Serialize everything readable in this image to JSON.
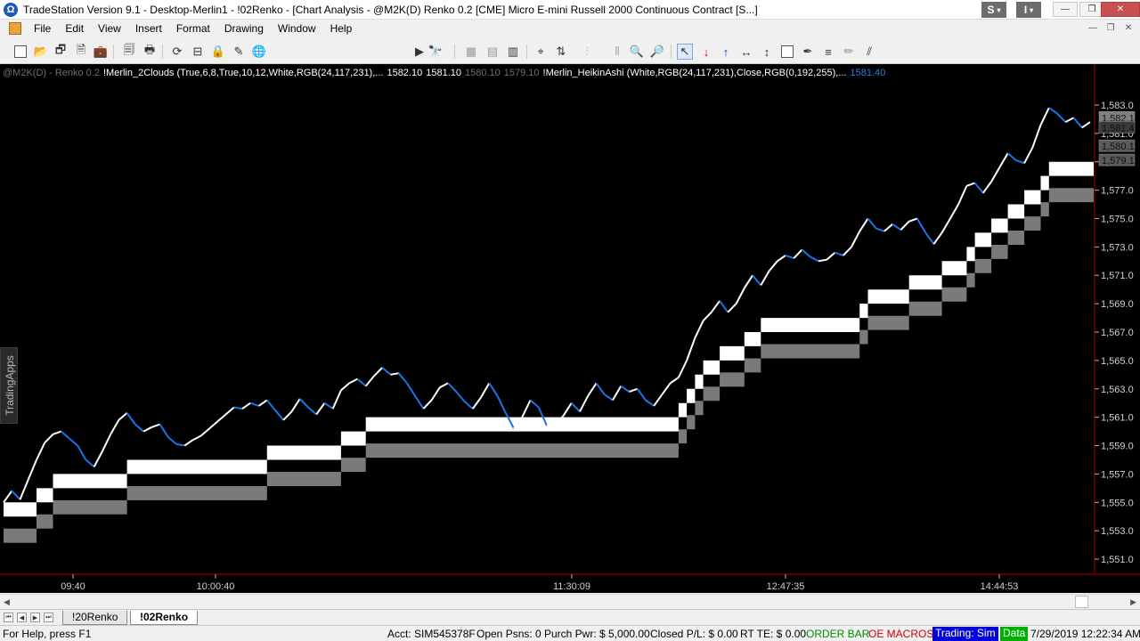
{
  "window": {
    "title": "TradeStation Version 9.1 - Desktop-Merlin1 - !02Renko - [Chart Analysis - @M2K(D) Renko 0.2 [CME] Micro E-mini Russell 2000 Continuous Contract [S...]",
    "app_icon_glyph": "Ω",
    "badge_s": "S",
    "badge_i": "I"
  },
  "menu": [
    "File",
    "Edit",
    "View",
    "Insert",
    "Format",
    "Drawing",
    "Window",
    "Help"
  ],
  "toolbar": {
    "combo_value": ".",
    "icons": [
      "new-document-icon",
      "open-folder-icon",
      "open-workspace-icon",
      "save-icon",
      "save-workspace-icon",
      "print-preview-icon",
      "print-icon",
      "window-refresh-icon",
      "window-arrange-icon",
      "lock-icon",
      "tool-icon",
      "globe-icon",
      "go-arrow-icon",
      "binoculars-icon",
      "grid-icon",
      "grid-alt-icon",
      "table-icon",
      "crosshair-icon",
      "strategy-icon",
      "zoom-in-icon",
      "zoom-out-icon",
      "pointer-icon",
      "down-arrow-icon",
      "up-arrow-icon",
      "horizontal-line-icon",
      "vertical-line-icon",
      "rectangle-icon",
      "pen-icon",
      "lines-icon",
      "pencil-icon",
      "trendlines-icon"
    ]
  },
  "legend": {
    "symbol": "@M2K(D) - Renko 0.2",
    "study1": "!Merlin_2Clouds (True,6,8,True,10,12,White,RGB(24,117,231),...",
    "v1": "1582.10",
    "v2": "1581.10",
    "v3": "1580.10",
    "v4": "1579.10",
    "study2": "!Merlin_HeikinAshi (White,RGB(24,117,231),Close,RGB(0,192,255),...",
    "v5": "1581.40"
  },
  "side_tab": "TradingApps",
  "chart_data": {
    "type": "line",
    "y_range": [
      1550.0,
      1584.0
    ],
    "y_ticks": [
      "1,583.0",
      "1,581.0",
      "1,579.0",
      "1,577.0",
      "1,575.0",
      "1,573.0",
      "1,571.0",
      "1,569.0",
      "1,567.0",
      "1,565.0",
      "1,563.0",
      "1,561.0",
      "1,559.0",
      "1,557.0",
      "1,555.0",
      "1,553.0",
      "1,551.0"
    ],
    "x_ticks": [
      "09:40",
      "10:00:40",
      "11:30:09",
      "12:47:35",
      "14:44:53"
    ],
    "price_labels": [
      "1,582.1",
      "1,581.4",
      "1,580.1",
      "1,579.1"
    ],
    "grid": false,
    "colors": {
      "up": "#ffffff",
      "down": "#1875e7",
      "cloud1": "#ffffff",
      "cloud2": "#7a7a7a",
      "axis": "#b00000"
    },
    "price": [
      1555.0,
      1555.8,
      1555.2,
      1556.6,
      1558.0,
      1559.2,
      1559.8,
      1560.0,
      1559.5,
      1559.0,
      1558.0,
      1557.5,
      1558.6,
      1559.8,
      1560.8,
      1561.3,
      1560.5,
      1560.0,
      1560.3,
      1560.5,
      1559.6,
      1559.1,
      1559.0,
      1559.4,
      1559.7,
      1560.2,
      1560.7,
      1561.2,
      1561.7,
      1561.6,
      1562.0,
      1561.8,
      1562.2,
      1561.5,
      1560.8,
      1561.4,
      1562.3,
      1561.7,
      1561.2,
      1562.0,
      1561.6,
      1562.9,
      1563.4,
      1563.7,
      1563.2,
      1563.9,
      1564.5,
      1564.0,
      1564.1,
      1563.4,
      1562.5,
      1561.6,
      1562.2,
      1563.1,
      1563.4,
      1562.8,
      1562.1,
      1561.6,
      1562.4,
      1563.4,
      1562.5,
      1561.3,
      1560.2,
      1561.0,
      1562.2,
      1561.7,
      1560.4,
      1560.5,
      1561.1,
      1562.0,
      1561.4,
      1562.5,
      1563.4,
      1562.6,
      1562.2,
      1563.2,
      1562.8,
      1563.0,
      1562.2,
      1561.8,
      1562.6,
      1563.4,
      1563.8,
      1565.0,
      1566.6,
      1567.8,
      1568.4,
      1569.2,
      1568.4,
      1569.0,
      1570.1,
      1571.0,
      1570.3,
      1571.3,
      1572.0,
      1572.4,
      1572.2,
      1572.8,
      1572.3,
      1572.0,
      1572.1,
      1572.6,
      1572.4,
      1573.0,
      1574.1,
      1575.0,
      1574.3,
      1574.1,
      1574.6,
      1574.2,
      1574.8,
      1575.0,
      1574.0,
      1573.2,
      1574.0,
      1575.0,
      1576.0,
      1577.3,
      1577.5,
      1576.8,
      1577.6,
      1578.6,
      1579.6,
      1579.1,
      1578.9,
      1580.0,
      1581.6,
      1582.8,
      1582.4,
      1581.8,
      1582.1,
      1581.4,
      1581.8
    ],
    "cloud1_upper": [
      1555.0,
      1555.0,
      1555.0,
      1555.0,
      1556.0,
      1556.0,
      1557.0,
      1557.0,
      1557.0,
      1557.0,
      1557.0,
      1557.0,
      1557.0,
      1557.0,
      1557.0,
      1558.0,
      1558.0,
      1558.0,
      1558.0,
      1558.0,
      1558.0,
      1558.0,
      1558.0,
      1558.0,
      1558.0,
      1558.0,
      1558.0,
      1558.0,
      1558.0,
      1558.0,
      1558.0,
      1558.0,
      1559.0,
      1559.0,
      1559.0,
      1559.0,
      1559.0,
      1559.0,
      1559.0,
      1559.0,
      1559.0,
      1560.0,
      1560.0,
      1560.0,
      1561.0,
      1561.0,
      1561.0,
      1561.0,
      1561.0,
      1561.0,
      1561.0,
      1561.0,
      1561.0,
      1561.0,
      1561.0,
      1561.0,
      1561.0,
      1561.0,
      1561.0,
      1561.0,
      1561.0,
      1561.0,
      1561.0,
      1561.0,
      1561.0,
      1561.0,
      1561.0,
      1561.0,
      1561.0,
      1561.0,
      1561.0,
      1561.0,
      1561.0,
      1561.0,
      1561.0,
      1561.0,
      1561.0,
      1561.0,
      1561.0,
      1561.0,
      1561.0,
      1561.0,
      1562.0,
      1563.0,
      1564.0,
      1565.0,
      1565.0,
      1566.0,
      1566.0,
      1566.0,
      1567.0,
      1567.0,
      1568.0,
      1568.0,
      1568.0,
      1568.0,
      1568.0,
      1568.0,
      1568.0,
      1568.0,
      1568.0,
      1568.0,
      1568.0,
      1568.0,
      1569.0,
      1570.0,
      1570.0,
      1570.0,
      1570.0,
      1570.0,
      1571.0,
      1571.0,
      1571.0,
      1571.0,
      1572.0,
      1572.0,
      1572.0,
      1573.0,
      1574.0,
      1574.0,
      1575.0,
      1575.0,
      1576.0,
      1576.0,
      1577.0,
      1577.0,
      1578.0,
      1579.0,
      1579.0,
      1579.0,
      1579.0,
      1579.0,
      1579.0
    ],
    "cloud_band": 1.0,
    "cloud_gap": 0.85
  },
  "status": {
    "help": "For Help, press F1",
    "acct": "Acct: SIM545378F",
    "open_psns": "Open Psns: 0",
    "purch_pwr": "Purch Pwr: $ 5,000.00",
    "closed_pl": "Closed P/L: $ 0.00",
    "rt_te": "RT TE: $ 0.00",
    "order_bar": "ORDER BAR",
    "oe_macros": "OE MACROS",
    "trading": "Trading: Sim",
    "data": "Data",
    "datetime": "7/29/2019 12:22:34 AM"
  },
  "tabs": [
    "!20Renko",
    "!02Renko"
  ]
}
